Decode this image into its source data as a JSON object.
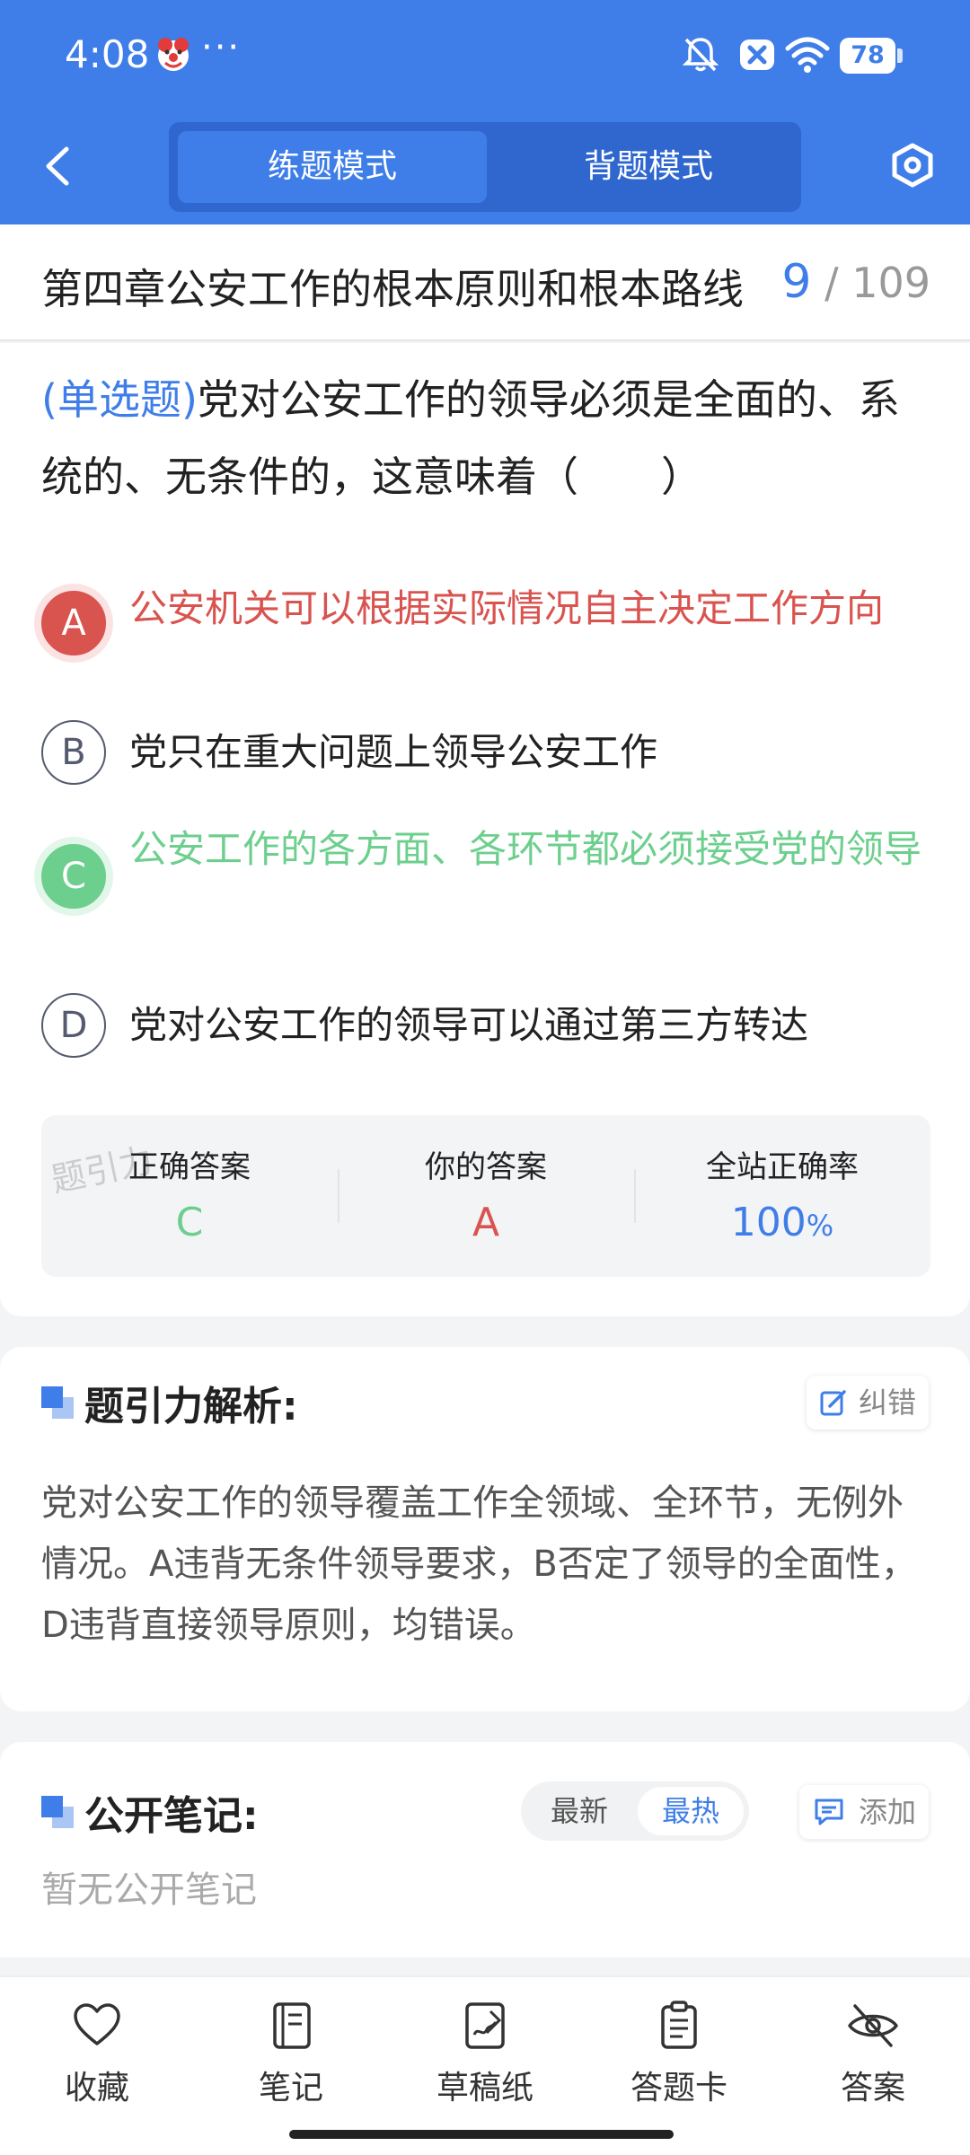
{
  "status_bar": {
    "time": "4:08",
    "dots": "···",
    "battery": "78"
  },
  "header": {
    "modes": [
      "练题模式",
      "背题模式"
    ],
    "active_mode": "练题模式"
  },
  "chapter": {
    "title": "第四章公安工作的根本原则和根本路线",
    "current": "9",
    "total": "/ 109"
  },
  "question": {
    "type_label": "(单选题)",
    "text": "党对公安工作的领导必须是全面的、系统的、无条件的，这意味着（　　）",
    "options": [
      {
        "letter": "A",
        "text": "公安机关可以根据实际情况自主决定工作方向",
        "state": "wrong"
      },
      {
        "letter": "B",
        "text": "党只在重大问题上领导公安工作",
        "state": "normal"
      },
      {
        "letter": "C",
        "text": "公安工作的各方面、各环节都必须接受党的领导",
        "state": "correct"
      },
      {
        "letter": "D",
        "text": "党对公安工作的领导可以通过第三方转达",
        "state": "normal"
      }
    ]
  },
  "result": {
    "correct_label": "正确答案",
    "correct_value": "C",
    "yours_label": "你的答案",
    "yours_value": "A",
    "rate_label": "全站正确率",
    "rate_value": "100",
    "rate_unit": "%",
    "watermark": "题引力"
  },
  "analysis": {
    "title": "题引力解析:",
    "correct_btn": "纠错",
    "text": "党对公安工作的领导覆盖工作全领域、全环节，无例外情况。A违背无条件领导要求，B否定了领导的全面性，D违背直接领导原则，均错误。"
  },
  "notes": {
    "title": "公开笔记:",
    "sort_new": "最新",
    "sort_hot": "最热",
    "add_btn": "添加",
    "empty": "暂无公开笔记"
  },
  "bottom_nav": {
    "favorite": "收藏",
    "notes": "笔记",
    "draft": "草稿纸",
    "answer_card": "答题卡",
    "answer": "答案"
  },
  "colors": {
    "primary": "#3f7ee8",
    "wrong": "#d9534f",
    "correct": "#6dcf8d"
  }
}
